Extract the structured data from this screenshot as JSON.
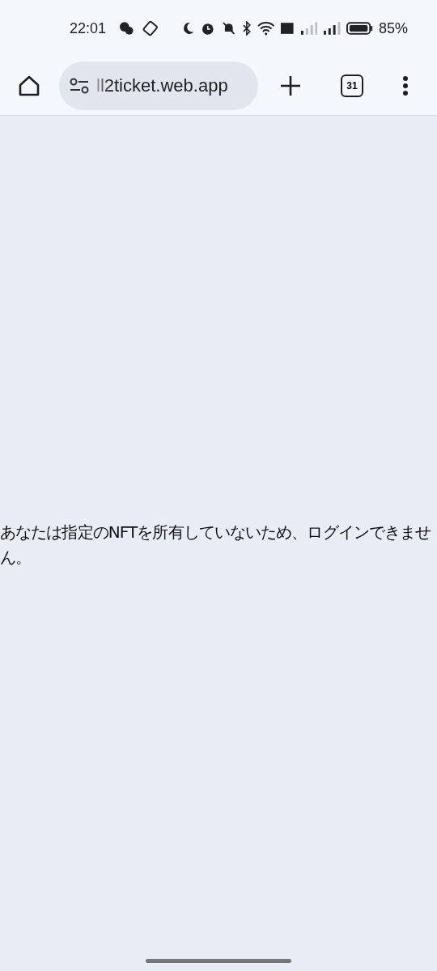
{
  "status_bar": {
    "time": "22:01",
    "battery": "85%"
  },
  "toolbar": {
    "url": "ll2ticket.web.app",
    "tab_count": "31"
  },
  "page": {
    "message": "あなたは指定のNFTを所有していないため、ログインできません。"
  }
}
